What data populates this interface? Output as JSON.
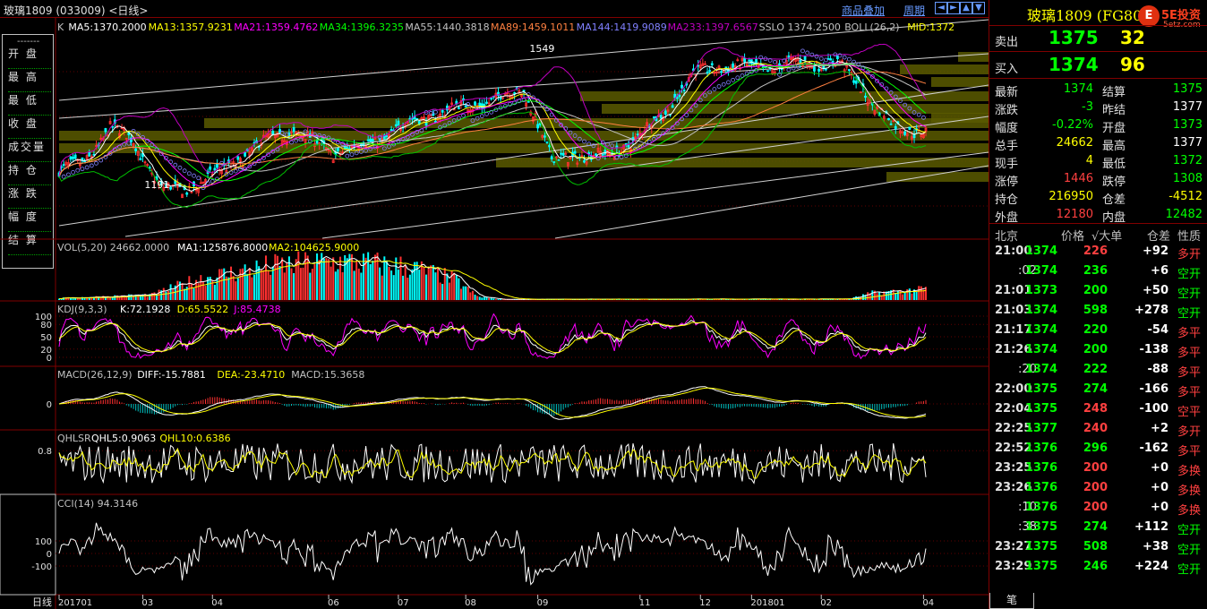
{
  "header": {
    "title": "玻璃1809 (033009) <日线>",
    "link_overlay": "商品叠加",
    "link_period": "周期",
    "nav_icons": [
      "arrow-left-icon",
      "arrow-right-icon",
      "arrow-up-icon",
      "arrow-down-icon"
    ]
  },
  "left_menu": {
    "dash": "-------",
    "items": [
      "开  盘",
      "最  高",
      "最  低",
      "收  盘",
      "成交量",
      "持  仓",
      "涨  跌",
      "幅  度",
      "结  算"
    ]
  },
  "panels": {
    "main": {
      "legend": [
        {
          "text": "K",
          "color": "#c0c0c0"
        },
        {
          "text": "MA5:1370.2000",
          "color": "#ffffff"
        },
        {
          "text": "MA13:1357.9231",
          "color": "#ffff00"
        },
        {
          "text": "MA21:1359.4762",
          "color": "#ff00ff"
        },
        {
          "text": "MA34:1396.3235",
          "color": "#00ff00"
        },
        {
          "text": "MA55:1440.3818",
          "color": "#c0c0c0"
        },
        {
          "text": "MA89:1459.1011",
          "color": "#ff8040"
        },
        {
          "text": "MA144:1419.9089",
          "color": "#8080ff"
        },
        {
          "text": "MA233:1397.6567",
          "color": "#c000c0"
        },
        {
          "text": "SSLO 1374.2500",
          "color": "#c0c0c0"
        },
        {
          "text": "BOLL(26,2)",
          "color": "#c0c0c0"
        },
        {
          "text": "MID:1372",
          "color": "#ffff00"
        }
      ],
      "annotations": [
        {
          "text": "1549",
          "index": 214
        },
        {
          "text": "1191",
          "index": 46
        }
      ]
    },
    "vol": {
      "legend": [
        {
          "text": "VOL(5,20) 24662.0000",
          "color": "#c0c0c0"
        },
        {
          "text": "MA1:125876.8000",
          "color": "#ffffff"
        },
        {
          "text": "MA2:104625.9000",
          "color": "#ffff00"
        }
      ]
    },
    "kdj": {
      "legend": [
        {
          "text": "KDJ(9,3,3)",
          "color": "#c0c0c0"
        },
        {
          "text": "K:72.1928",
          "color": "#ffffff"
        },
        {
          "text": "D:65.5522",
          "color": "#ffff00"
        },
        {
          "text": "J:85.4738",
          "color": "#ff00ff"
        }
      ],
      "ticks": [
        "100",
        "80",
        "50",
        "20",
        "0"
      ]
    },
    "macd": {
      "legend": [
        {
          "text": "MACD(26,12,9)",
          "color": "#c0c0c0"
        },
        {
          "text": "DIFF:-15.7881",
          "color": "#ffffff"
        },
        {
          "text": "DEA:-23.4710",
          "color": "#ffff00"
        },
        {
          "text": "MACD:15.3658",
          "color": "#c0c0c0"
        }
      ],
      "ticks": [
        "0"
      ]
    },
    "qhlsr": {
      "legend": [
        {
          "text": "QHLSR",
          "color": "#c0c0c0"
        },
        {
          "text": "QHL5:0.9063",
          "color": "#ffffff"
        },
        {
          "text": "QHL10:0.6386",
          "color": "#ffff00"
        }
      ],
      "ticks": [
        "0.8"
      ]
    },
    "cci": {
      "legend": [
        {
          "text": "CCI(14) 94.3146",
          "color": "#c0c0c0"
        }
      ],
      "ticks": [
        "100",
        "0",
        "-100"
      ]
    }
  },
  "x_axis": {
    "period_label": "日线",
    "labels": [
      {
        "text": "201701",
        "index": 0
      },
      {
        "text": "03",
        "index": 36
      },
      {
        "text": "04",
        "index": 66
      },
      {
        "text": "06",
        "index": 116
      },
      {
        "text": "07",
        "index": 146
      },
      {
        "text": "08",
        "index": 175
      },
      {
        "text": "09",
        "index": 206
      },
      {
        "text": "11",
        "index": 250
      },
      {
        "text": "12",
        "index": 276
      },
      {
        "text": "201801",
        "index": 298
      },
      {
        "text": "02",
        "index": 328
      },
      {
        "text": "04",
        "index": 372
      }
    ]
  },
  "chart_data": {
    "type": "candlestick",
    "symbol": "玻璃1809",
    "period": "日线",
    "x_range": [
      "201701",
      "04"
    ],
    "y_range_approx": [
      1150,
      1580
    ],
    "highs_marked": {
      "max": 1549,
      "min": 1191
    },
    "close_keypoints": [
      {
        "i": 0,
        "v": 1290
      },
      {
        "i": 10,
        "v": 1305
      },
      {
        "i": 22,
        "v": 1380
      },
      {
        "i": 32,
        "v": 1355
      },
      {
        "i": 44,
        "v": 1250
      },
      {
        "i": 56,
        "v": 1255
      },
      {
        "i": 70,
        "v": 1290
      },
      {
        "i": 88,
        "v": 1350
      },
      {
        "i": 100,
        "v": 1375
      },
      {
        "i": 118,
        "v": 1330
      },
      {
        "i": 135,
        "v": 1350
      },
      {
        "i": 150,
        "v": 1390
      },
      {
        "i": 170,
        "v": 1420
      },
      {
        "i": 188,
        "v": 1440
      },
      {
        "i": 200,
        "v": 1460
      },
      {
        "i": 205,
        "v": 1405
      },
      {
        "i": 212,
        "v": 1310
      },
      {
        "i": 222,
        "v": 1325
      },
      {
        "i": 236,
        "v": 1320
      },
      {
        "i": 250,
        "v": 1365
      },
      {
        "i": 262,
        "v": 1420
      },
      {
        "i": 272,
        "v": 1490
      },
      {
        "i": 285,
        "v": 1510
      },
      {
        "i": 305,
        "v": 1505
      },
      {
        "i": 320,
        "v": 1518
      },
      {
        "i": 335,
        "v": 1515
      },
      {
        "i": 345,
        "v": 1470
      },
      {
        "i": 352,
        "v": 1420
      },
      {
        "i": 360,
        "v": 1380
      },
      {
        "i": 370,
        "v": 1375
      }
    ],
    "volume_profile": [
      {
        "i": 0,
        "v": 5
      },
      {
        "i": 40,
        "v": 15
      },
      {
        "i": 60,
        "v": 60
      },
      {
        "i": 90,
        "v": 95
      },
      {
        "i": 120,
        "v": 110
      },
      {
        "i": 150,
        "v": 95
      },
      {
        "i": 170,
        "v": 60
      },
      {
        "i": 180,
        "v": 10
      },
      {
        "i": 190,
        "v": 2
      },
      {
        "i": 340,
        "v": 3
      },
      {
        "i": 350,
        "v": 20
      },
      {
        "i": 372,
        "v": 30
      }
    ],
    "latest": {
      "MA5": 1370.2,
      "MA13": 1357.9231,
      "MA21": 1359.4762,
      "MA34": 1396.3235,
      "MA55": 1440.3818,
      "MA89": 1459.1011,
      "MA144": 1419.9089,
      "MA233": 1397.6567,
      "SSLO": 1374.25,
      "BOLL_MID": 1372,
      "VOL": 24662,
      "VOL_MA1": 125876.8,
      "VOL_MA2": 104625.9,
      "K": 72.1928,
      "D": 65.5522,
      "J": 85.4738,
      "DIFF": -15.7881,
      "DEA": -23.471,
      "MACD": 15.3658,
      "QHL5": 0.9063,
      "QHL10": 0.6386,
      "CCI": 94.3146
    }
  },
  "quote": {
    "title": "玻璃1809 (FG809)",
    "logo": {
      "brand": "5E投资",
      "domain": "5etz.com",
      "glyph": "E"
    },
    "ask": {
      "label": "卖出",
      "price": "1375",
      "qty": "32"
    },
    "bid": {
      "label": "买入",
      "price": "1374",
      "qty": "96"
    },
    "rows": [
      {
        "l1": "最新",
        "v1": "1374",
        "c1": "#00ff00",
        "l2": "结算",
        "v2": "1375",
        "c2": "#00ff00"
      },
      {
        "l1": "涨跌",
        "v1": "-3",
        "c1": "#00ff00",
        "l2": "昨结",
        "v2": "1377",
        "c2": "#ffffff"
      },
      {
        "l1": "幅度",
        "v1": "-0.22%",
        "c1": "#00ff00",
        "l2": "开盘",
        "v2": "1373",
        "c2": "#00ff00"
      },
      {
        "l1": "总手",
        "v1": "24662",
        "c1": "#ffff00",
        "l2": "最高",
        "v2": "1377",
        "c2": "#ffffff"
      },
      {
        "l1": "现手",
        "v1": "4",
        "c1": "#ffff00",
        "l2": "最低",
        "v2": "1372",
        "c2": "#00ff00"
      },
      {
        "l1": "涨停",
        "v1": "1446",
        "c1": "#ff4040",
        "l2": "跌停",
        "v2": "1308",
        "c2": "#00ff00"
      },
      {
        "l1": "持仓",
        "v1": "216950",
        "c1": "#ffff00",
        "l2": "仓差",
        "v2": "-4512",
        "c2": "#ffff00"
      },
      {
        "l1": "外盘",
        "v1": "12180",
        "c1": "#ff4040",
        "l2": "内盘",
        "v2": "12482",
        "c2": "#00ff00"
      }
    ],
    "ticks_header": [
      "北京",
      "价格",
      "√大单",
      "仓差",
      "性质"
    ],
    "ticks": [
      {
        "time": "21:00",
        "sub": false,
        "price": "1374",
        "vol": "226",
        "vc": "#ff4040",
        "oi": "+92",
        "nat": "多开",
        "nc": "#ff4040"
      },
      {
        "time": ":02",
        "sub": true,
        "price": "1374",
        "vol": "236",
        "vc": "#00ff00",
        "oi": "+6",
        "nat": "空开",
        "nc": "#00ff00"
      },
      {
        "time": "21:01",
        "sub": false,
        "price": "1373",
        "vol": "200",
        "vc": "#00ff00",
        "oi": "+50",
        "nat": "空开",
        "nc": "#00ff00"
      },
      {
        "time": "21:03",
        "sub": false,
        "price": "1374",
        "vol": "598",
        "vc": "#00ff00",
        "oi": "+278",
        "nat": "空开",
        "nc": "#00ff00"
      },
      {
        "time": "21:17",
        "sub": false,
        "price": "1374",
        "vol": "220",
        "vc": "#00ff00",
        "oi": "-54",
        "nat": "多平",
        "nc": "#ff4040"
      },
      {
        "time": "21:26",
        "sub": false,
        "price": "1374",
        "vol": "200",
        "vc": "#00ff00",
        "oi": "-138",
        "nat": "多平",
        "nc": "#ff4040"
      },
      {
        "time": ":20",
        "sub": true,
        "price": "1374",
        "vol": "222",
        "vc": "#00ff00",
        "oi": "-88",
        "nat": "多平",
        "nc": "#ff4040"
      },
      {
        "time": "22:00",
        "sub": false,
        "price": "1375",
        "vol": "274",
        "vc": "#00ff00",
        "oi": "-166",
        "nat": "多平",
        "nc": "#ff4040"
      },
      {
        "time": "22:04",
        "sub": false,
        "price": "1375",
        "vol": "248",
        "vc": "#ff4040",
        "oi": "-100",
        "nat": "空平",
        "nc": "#ff4040"
      },
      {
        "time": "22:25",
        "sub": false,
        "price": "1377",
        "vol": "240",
        "vc": "#ff4040",
        "oi": "+2",
        "nat": "多开",
        "nc": "#ff4040"
      },
      {
        "time": "22:52",
        "sub": false,
        "price": "1376",
        "vol": "296",
        "vc": "#00ff00",
        "oi": "-162",
        "nat": "多平",
        "nc": "#ff4040"
      },
      {
        "time": "23:25",
        "sub": false,
        "price": "1376",
        "vol": "200",
        "vc": "#ff4040",
        "oi": "+0",
        "nat": "多换",
        "nc": "#ff4040"
      },
      {
        "time": "23:26",
        "sub": false,
        "price": "1376",
        "vol": "200",
        "vc": "#ff4040",
        "oi": "+0",
        "nat": "多换",
        "nc": "#ff4040"
      },
      {
        "time": ":10",
        "sub": true,
        "price": "1376",
        "vol": "200",
        "vc": "#ff4040",
        "oi": "+0",
        "nat": "多换",
        "nc": "#ff4040"
      },
      {
        "time": ":38",
        "sub": true,
        "price": "1375",
        "vol": "274",
        "vc": "#00ff00",
        "oi": "+112",
        "nat": "空开",
        "nc": "#00ff00"
      },
      {
        "time": "23:27",
        "sub": false,
        "price": "1375",
        "vol": "508",
        "vc": "#00ff00",
        "oi": "+38",
        "nat": "空开",
        "nc": "#00ff00"
      },
      {
        "time": "23:29",
        "sub": false,
        "price": "1375",
        "vol": "246",
        "vc": "#00ff00",
        "oi": "+224",
        "nat": "空开",
        "nc": "#00ff00"
      }
    ],
    "footer_tab": "笔"
  }
}
